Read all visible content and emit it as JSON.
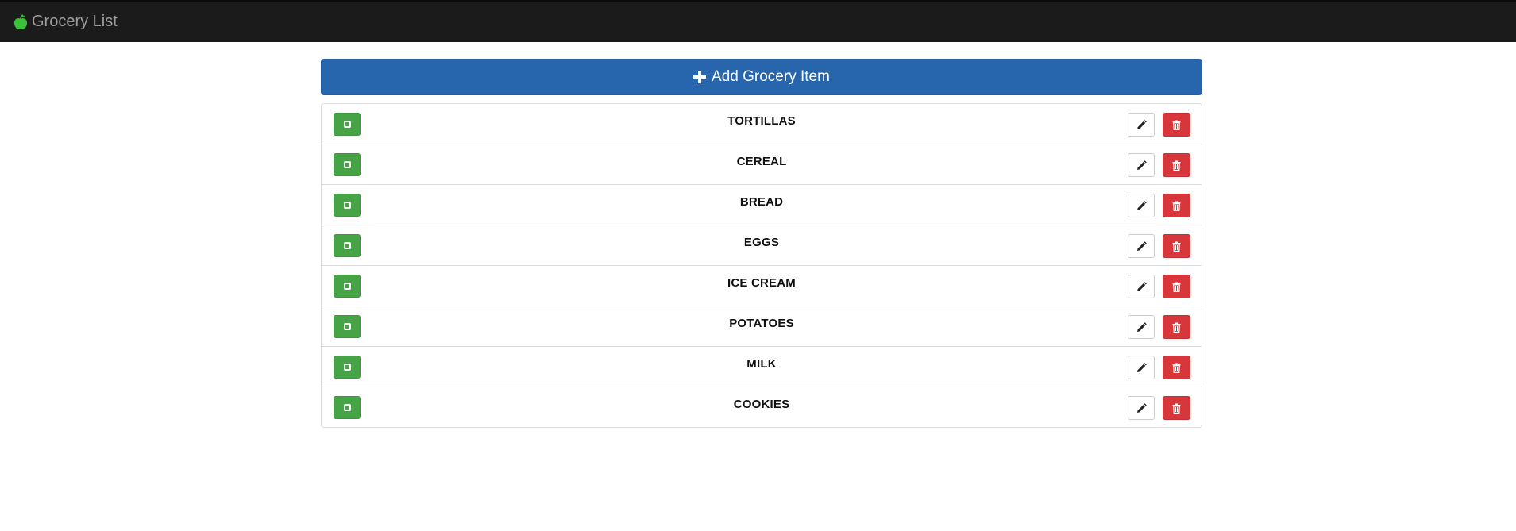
{
  "navbar": {
    "brand_label": "Grocery List",
    "brand_icon": "apple-icon",
    "brand_icon_color": "#3cc13b"
  },
  "toolbar": {
    "add_label": "Add Grocery Item",
    "add_icon": "plus-icon"
  },
  "colors": {
    "primary": "#2765ad",
    "success": "#46a346",
    "danger": "#d7373a",
    "navbar_bg": "#1b1b1b"
  },
  "items": [
    {
      "name": "TORTILLAS"
    },
    {
      "name": "CEREAL"
    },
    {
      "name": "BREAD"
    },
    {
      "name": "EGGS"
    },
    {
      "name": "ICE CREAM"
    },
    {
      "name": "POTATOES"
    },
    {
      "name": "MILK"
    },
    {
      "name": "COOKIES"
    }
  ],
  "row_actions": {
    "check_icon": "checkbox-unchecked-icon",
    "edit_icon": "pencil-icon",
    "delete_icon": "trash-icon"
  }
}
